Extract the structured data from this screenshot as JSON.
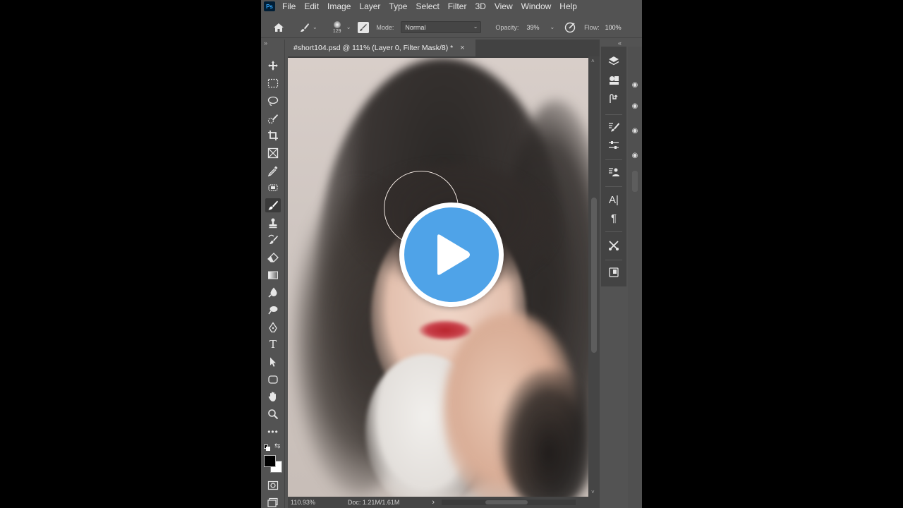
{
  "app": {
    "logo_text": "Ps",
    "name": "Photoshop"
  },
  "menu": {
    "items": [
      "File",
      "Edit",
      "Image",
      "Layer",
      "Type",
      "Select",
      "Filter",
      "3D",
      "View",
      "Window",
      "Help"
    ]
  },
  "options_bar": {
    "brush_size": "129",
    "mode_label": "Mode:",
    "mode_value": "Normal",
    "opacity_label": "Opacity:",
    "opacity_value": "39%",
    "flow_label": "Flow:",
    "flow_value": "100%"
  },
  "document": {
    "tab_title": "#short104.psd @ 111% (Layer 0, Filter Mask/8) *",
    "close_glyph": "×"
  },
  "status_bar": {
    "zoom": "110.93%",
    "doc_info": "Doc: 1.21M/1.61M",
    "arrow": "›"
  },
  "tools": [
    {
      "name": "move-tool",
      "glyph": "✥"
    },
    {
      "name": "marquee-tool",
      "glyph": "⬚"
    },
    {
      "name": "lasso-tool",
      "glyph": "◯"
    },
    {
      "name": "quick-selection-tool",
      "glyph": "✎"
    },
    {
      "name": "crop-tool",
      "glyph": "⌗"
    },
    {
      "name": "frame-tool",
      "glyph": "☒"
    },
    {
      "name": "eyedropper-tool",
      "glyph": "✒"
    },
    {
      "name": "healing-tool",
      "glyph": "▦"
    },
    {
      "name": "brush-tool",
      "glyph": "🖌"
    },
    {
      "name": "clone-stamp-tool",
      "glyph": "♟"
    },
    {
      "name": "history-brush-tool",
      "glyph": "↺"
    },
    {
      "name": "eraser-tool",
      "glyph": "◪"
    },
    {
      "name": "gradient-tool",
      "glyph": "▭"
    },
    {
      "name": "blur-tool",
      "glyph": "◍"
    },
    {
      "name": "dodge-tool",
      "glyph": "●"
    },
    {
      "name": "pen-tool",
      "glyph": "✑"
    },
    {
      "name": "type-tool",
      "glyph": "T"
    },
    {
      "name": "path-selection-tool",
      "glyph": "➤"
    },
    {
      "name": "shape-tool",
      "glyph": "▢"
    },
    {
      "name": "hand-tool",
      "glyph": "✋"
    },
    {
      "name": "zoom-tool",
      "glyph": "⚲"
    },
    {
      "name": "more-tools",
      "glyph": "⋯"
    }
  ],
  "colors": {
    "foreground": "#000000",
    "background": "#ffffff",
    "ui_panel": "#535353",
    "play_accent": "#4fa3e8"
  },
  "overlay": {
    "play_icon": "play-icon"
  }
}
